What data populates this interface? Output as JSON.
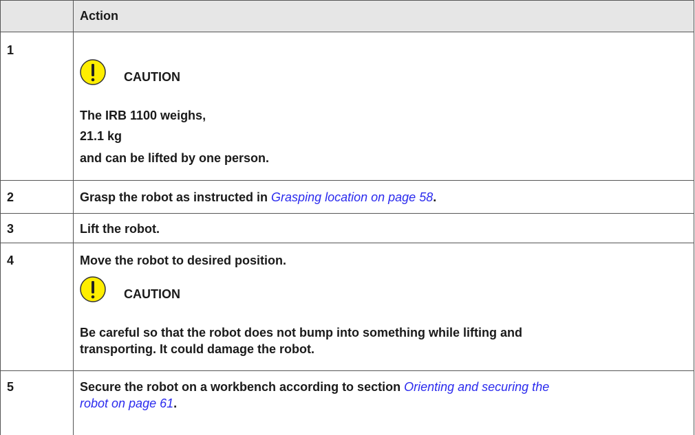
{
  "table": {
    "header": {
      "step_col": "",
      "action_col": "Action"
    },
    "rows": [
      {
        "step": "1",
        "caution_label": "CAUTION",
        "lines": [
          "The IRB 1100 weighs,",
          "21.1 kg",
          "and can be lifted by one person."
        ]
      },
      {
        "step": "2",
        "text_before": "Grasp the robot as instructed in ",
        "link": "Grasping location on page 58",
        "text_after": "."
      },
      {
        "step": "3",
        "text": "Lift the robot."
      },
      {
        "step": "4",
        "text": "Move the robot to desired position.",
        "caution_label": "CAUTION",
        "caution_lines": [
          "Be careful so that the robot does not bump into something while lifting and",
          "transporting. It could damage the robot."
        ]
      },
      {
        "step": "5",
        "text_before": "Secure the robot on a workbench according to section ",
        "link_line1": "Orienting and securing the",
        "link_line2": "robot on page 61",
        "text_after": "."
      }
    ]
  },
  "colors": {
    "header_bg": "#e6e6e6",
    "caution_fill": "#ffee00",
    "link": "#2a2aee"
  },
  "icons": {
    "caution": "exclamation-warning-icon"
  }
}
